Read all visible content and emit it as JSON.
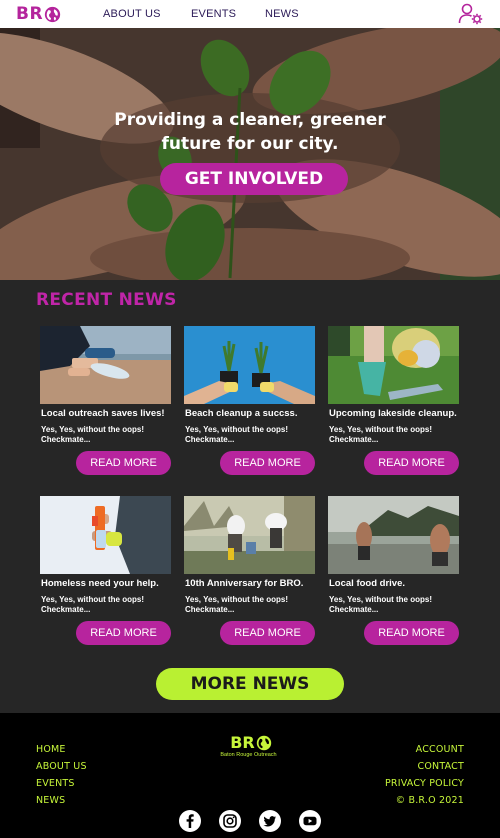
{
  "header": {
    "logo_text": "BR",
    "nav": [
      "ABOUT US",
      "EVENTS",
      "NEWS"
    ]
  },
  "hero": {
    "title_line1": "Providing a cleaner, greener",
    "title_line2": "future for our city.",
    "cta": "GET INVOLVED"
  },
  "news": {
    "heading": "RECENT NEWS",
    "read_more": "READ MORE",
    "cards": [
      {
        "title": "Local outreach saves lives!",
        "desc_line1": "Yes, Yes, without the oops!",
        "desc_line2": "Checkmate..."
      },
      {
        "title": "Beach cleanup a succss.",
        "desc_line1": "Yes, Yes, without the oops!",
        "desc_line2": "Checkmate..."
      },
      {
        "title": "Upcoming lakeside cleanup.",
        "desc_line1": "Yes, Yes, without the oops!",
        "desc_line2": "Checkmate..."
      },
      {
        "title": "Homeless need your help.",
        "desc_line1": "Yes, Yes, without the oops!",
        "desc_line2": "Checkmate..."
      },
      {
        "title": "10th Anniversary for BRO.",
        "desc_line1": "Yes, Yes, without the oops!",
        "desc_line2": "Checkmate..."
      },
      {
        "title": "Local food drive.",
        "desc_line1": "Yes, Yes, without the oops!",
        "desc_line2": "Checkmate..."
      }
    ],
    "more": "MORE NEWS"
  },
  "footer": {
    "left_links": [
      "HOME",
      "ABOUT US",
      "EVENTS",
      "NEWS"
    ],
    "right_links": [
      "ACCOUNT",
      "CONTACT",
      "PRIVACY POLICY",
      "© B.R.O 2021"
    ],
    "logo_text": "BR",
    "logo_sub": "Baton Rouge Outreach",
    "social": [
      "facebook-icon",
      "instagram-icon",
      "twitter-icon",
      "youtube-icon"
    ]
  },
  "colors": {
    "brand_magenta": "#b7249e",
    "accent_lime": "#b9f032",
    "background_dark": "#262626"
  }
}
